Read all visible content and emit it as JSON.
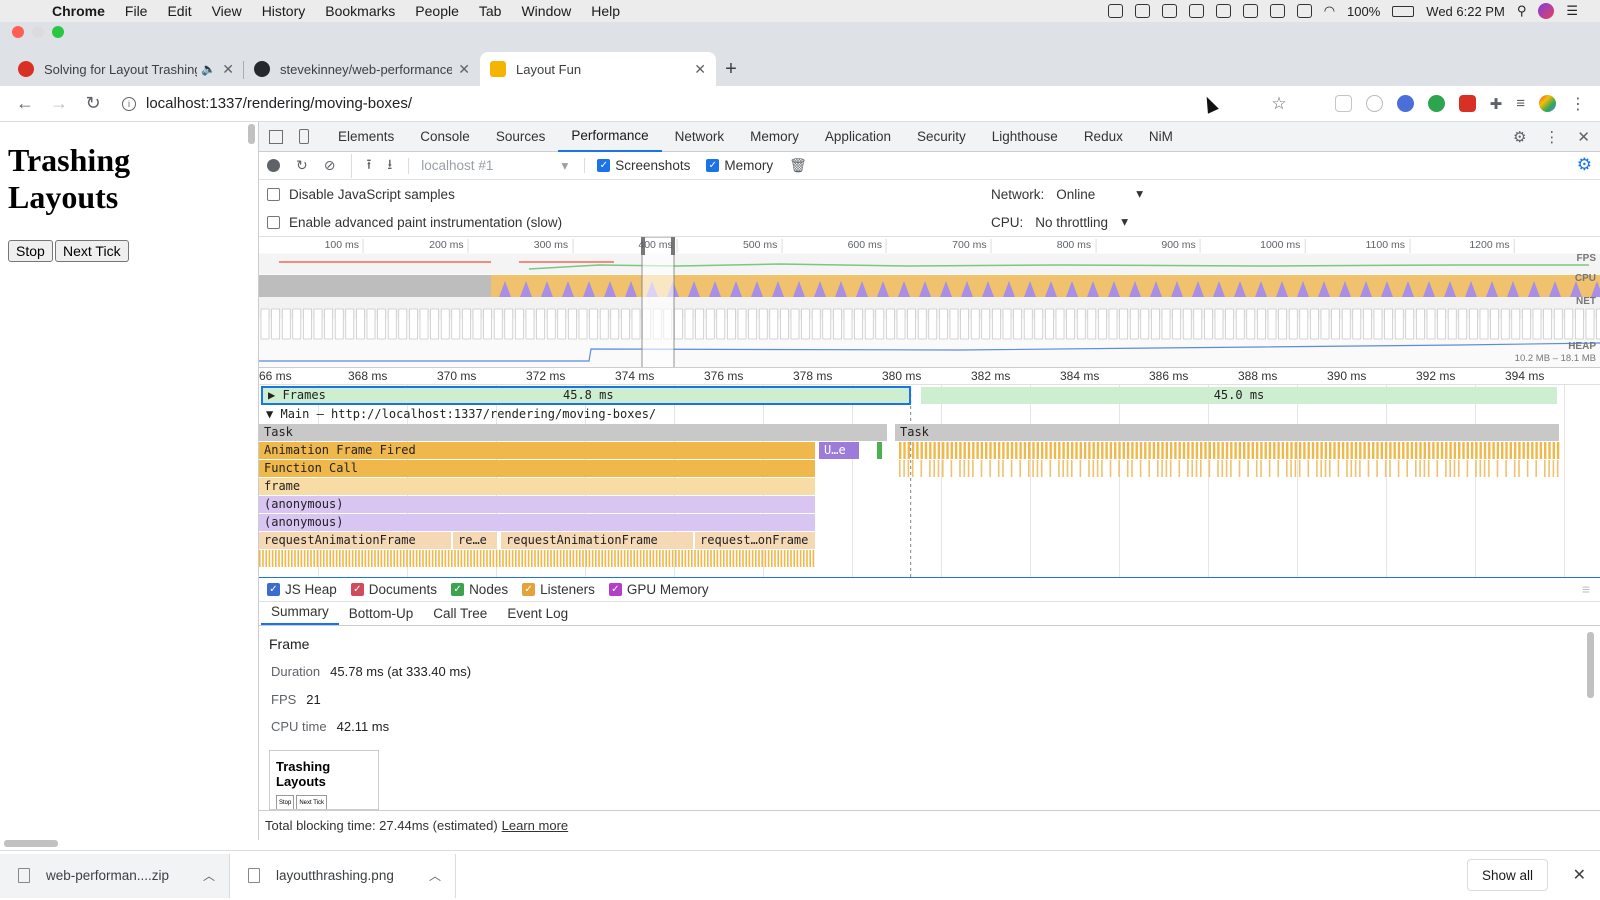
{
  "menubar": {
    "app": "Chrome",
    "items": [
      "File",
      "Edit",
      "View",
      "History",
      "Bookmarks",
      "People",
      "Tab",
      "Window",
      "Help"
    ],
    "battery": "100%",
    "clock": "Wed 6:22 PM"
  },
  "tabs": [
    {
      "title": "Solving for Layout Trashing",
      "favicon_color": "#d93025",
      "active": false
    },
    {
      "title": "stevekinney/web-performance",
      "favicon_color": "#24292e",
      "active": false
    },
    {
      "title": "Layout Fun",
      "favicon_color": "#f4b400",
      "active": true
    }
  ],
  "address": {
    "url": "localhost:1337/rendering/moving-boxes/"
  },
  "page": {
    "heading": "Trashing Layouts",
    "stop_label": "Stop",
    "next_tick_label": "Next Tick"
  },
  "devtools": {
    "tabs": [
      "Elements",
      "Console",
      "Sources",
      "Performance",
      "Network",
      "Memory",
      "Application",
      "Security",
      "Lighthouse",
      "Redux",
      "NiM"
    ],
    "active_tab": "Performance",
    "toolbar": {
      "profile_select": "localhost #1",
      "screenshots_label": "Screenshots",
      "memory_label": "Memory"
    },
    "options": {
      "disable_js_samples": "Disable JavaScript samples",
      "advanced_paint": "Enable advanced paint instrumentation (slow)",
      "network_label": "Network:",
      "network_value": "Online",
      "cpu_label": "CPU:",
      "cpu_value": "No throttling"
    },
    "overview": {
      "ticks": [
        "100 ms",
        "200 ms",
        "300 ms",
        "400 ms",
        "500 ms",
        "600 ms",
        "700 ms",
        "800 ms",
        "900 ms",
        "1000 ms",
        "1100 ms",
        "1200 ms"
      ],
      "lanes": [
        "FPS",
        "CPU",
        "NET",
        "HEAP"
      ],
      "heap_range": "10.2 MB – 18.1 MB"
    },
    "flame": {
      "ruler": [
        "66 ms",
        "368 ms",
        "370 ms",
        "372 ms",
        "374 ms",
        "376 ms",
        "378 ms",
        "380 ms",
        "382 ms",
        "384 ms",
        "386 ms",
        "388 ms",
        "390 ms",
        "392 ms",
        "394 ms"
      ],
      "frames_label": "Frames",
      "frame1_duration": "45.8 ms",
      "frame2_duration": "45.0 ms",
      "main_label": "Main — http://localhost:1337/rendering/moving-boxes/",
      "task": "Task",
      "task2": "Task",
      "animation_frame_fired": "Animation Frame Fired",
      "ue": "U…e",
      "function_call": "Function Call",
      "frame": "frame",
      "anon1": "(anonymous)",
      "anon2": "(anonymous)",
      "raf1": "requestAnimationFrame",
      "raf2": "re…e",
      "raf3": "requestAnimationFrame",
      "raf4": "request…onFrame"
    },
    "memory_checks": [
      "JS Heap",
      "Documents",
      "Nodes",
      "Listeners",
      "GPU Memory"
    ],
    "memory_colors": [
      "#3d6ccf",
      "#d04b5b",
      "#3ea34f",
      "#e4a33a",
      "#b33fc9"
    ],
    "subtabs": [
      "Summary",
      "Bottom-Up",
      "Call Tree",
      "Event Log"
    ],
    "summary": {
      "title": "Frame",
      "duration_label": "Duration",
      "duration_value": "45.78 ms (at 333.40 ms)",
      "fps_label": "FPS",
      "fps_value": "21",
      "cpu_label": "CPU time",
      "cpu_value": "42.11 ms",
      "thumb_heading": "Trashing Layouts",
      "thumb_btn1": "Stop",
      "thumb_btn2": "Next Tick"
    },
    "footer": {
      "text": "Total blocking time: 27.44ms (estimated)",
      "link": "Learn more"
    }
  },
  "downloads": [
    {
      "name": "web-performan....zip"
    },
    {
      "name": "layoutthrashing.png"
    }
  ],
  "show_all": "Show all"
}
